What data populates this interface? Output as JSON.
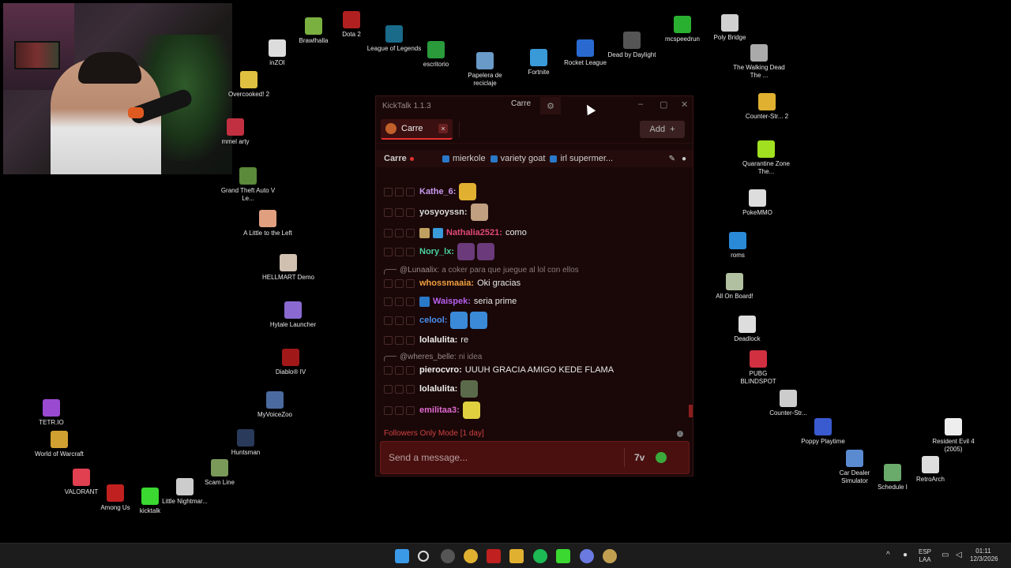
{
  "desktop_icons": [
    {
      "label": "Brawlhalla",
      "color": "#7ab040"
    },
    {
      "label": "Dota 2",
      "color": "#b02020"
    },
    {
      "label": "inZOI",
      "color": "#dcdcdc"
    },
    {
      "label": "League of Legends",
      "color": "#1a6a8a"
    },
    {
      "label": "escritorio",
      "color": "#2a9a3a"
    },
    {
      "label": "Papelera de reciclaje",
      "color": "#6a9ac8"
    },
    {
      "label": "Fortnite",
      "color": "#3a9ad8"
    },
    {
      "label": "Rocket League",
      "color": "#2a6ad0"
    },
    {
      "label": "Dead by Daylight",
      "color": "#555"
    },
    {
      "label": "mcspeedrun",
      "color": "#2ab030"
    },
    {
      "label": "Poly Bridge",
      "color": "#d0d0d0"
    },
    {
      "label": "Overcooked! 2",
      "color": "#e0c040"
    },
    {
      "label": "mmel arty",
      "color": "#c03040"
    },
    {
      "label": "Grand Theft Auto V Le...",
      "color": "#5a8a3a"
    },
    {
      "label": "A Little to the Left",
      "color": "#e0a080"
    },
    {
      "label": "HELLMART Demo",
      "color": "#d0c0b0"
    },
    {
      "label": "Hytale Launcher",
      "color": "#8a6ad0"
    },
    {
      "label": "Diablo® IV",
      "color": "#a01818"
    },
    {
      "label": "MyVoiceZoo",
      "color": "#4a6aa0"
    },
    {
      "label": "Huntsman",
      "color": "#2a3a5a"
    },
    {
      "label": "Scam Line",
      "color": "#7a9a5a"
    },
    {
      "label": "Little Nightmar...",
      "color": "#ccc"
    },
    {
      "label": "kicktalk",
      "color": "#3ad830"
    },
    {
      "label": "Among Us",
      "color": "#c02020"
    },
    {
      "label": "VALORANT",
      "color": "#e04050"
    },
    {
      "label": "World of Warcraft",
      "color": "#d0a030"
    },
    {
      "label": "TETR.IO",
      "color": "#9a4ad0"
    },
    {
      "label": "The Walking Dead The ...",
      "color": "#aaa"
    },
    {
      "label": "Counter-Str... 2",
      "color": "#e0b030"
    },
    {
      "label": "Quarantine Zone The...",
      "color": "#a0e020"
    },
    {
      "label": "PokeMMO",
      "color": "#ddd"
    },
    {
      "label": "roms",
      "color": "#2a8ad8"
    },
    {
      "label": "All On Board!",
      "color": "#b0c0a0"
    },
    {
      "label": "Deadlock",
      "color": "#ddd"
    },
    {
      "label": "PUBG BLINDSPOT",
      "color": "#d03040"
    },
    {
      "label": "Counter-Str...",
      "color": "#ccc"
    },
    {
      "label": "Poppy Playtime",
      "color": "#3a5ad0"
    },
    {
      "label": "Car Dealer Simulator",
      "color": "#5a8ad0"
    },
    {
      "label": "Schedule I",
      "color": "#6aaa6a"
    },
    {
      "label": "RetroArch",
      "color": "#ddd"
    },
    {
      "label": "Resident Evil 4 (2005)",
      "color": "#eee"
    }
  ],
  "kicktalk": {
    "title": "KickTalk 1.1.3",
    "titlebar_user": "Carre",
    "tab_name": "Carre",
    "tab_close": "×",
    "add_label": "Add",
    "add_plus": "+",
    "channel_name": "Carre",
    "channel_tags": [
      "mierkole",
      "variety goat",
      "irl supermer..."
    ],
    "follow_mode": "Followers Only Mode [1 day]",
    "input_placeholder": "Send a message...",
    "accent": "#e53030",
    "kick_green": "#53fc18"
  },
  "messages": [
    {
      "type": "msg",
      "user": "Kathe_6:",
      "color": "#c89af0",
      "text": "",
      "emotes": [
        "#e0b030"
      ]
    },
    {
      "type": "msg",
      "user": "yosyoyssn:",
      "color": "#dcdcdc",
      "text": "",
      "emotes": [
        "#c0a080"
      ]
    },
    {
      "type": "msg",
      "user": "Nathalia2521:",
      "color": "#e04878",
      "text": "como",
      "badges": [
        "#c0a060",
        "#3a9ad8"
      ]
    },
    {
      "type": "msg",
      "user": "Nory_lx:",
      "color": "#4ad0a0",
      "text": "",
      "emotes": [
        "#6a3a7a",
        "#6a3a7a"
      ]
    },
    {
      "type": "reply",
      "user": "@Lunaalix:",
      "text": "a coker para que juegue al lol con ellos"
    },
    {
      "type": "msg",
      "user": "whossmaaia:",
      "color": "#f0a040",
      "text": "Oki gracias"
    },
    {
      "type": "msg",
      "user": "Waispek:",
      "color": "#b860f0",
      "text": "seria prime",
      "badges": [
        "#2a78c8"
      ]
    },
    {
      "type": "msg",
      "user": "celool:",
      "color": "#4a90f0",
      "text": "",
      "emotes": [
        "#3a8ad8",
        "#3a8ad8"
      ]
    },
    {
      "type": "msg",
      "user": "lolalulita:",
      "color": "#f0f0f0",
      "text": "re"
    },
    {
      "type": "reply",
      "user": "@wheres_belle:",
      "text": "ni idea"
    },
    {
      "type": "msg",
      "user": "pierocvro:",
      "color": "#f0f0f0",
      "text": "UUUH GRACIA AMIGO KEDE FLAMA"
    },
    {
      "type": "msg",
      "user": "lolalulita:",
      "color": "#f0f0f0",
      "text": "",
      "emotes": [
        "#5a6a4a"
      ]
    },
    {
      "type": "msg",
      "user": "emilitaa3:",
      "color": "#e06ad0",
      "text": "",
      "emotes": [
        "#e0d040"
      ]
    }
  ],
  "taskbar": {
    "lang_top": "ESP",
    "lang_bottom": "LAA",
    "time": "01:11",
    "date": "12/3/2026"
  }
}
